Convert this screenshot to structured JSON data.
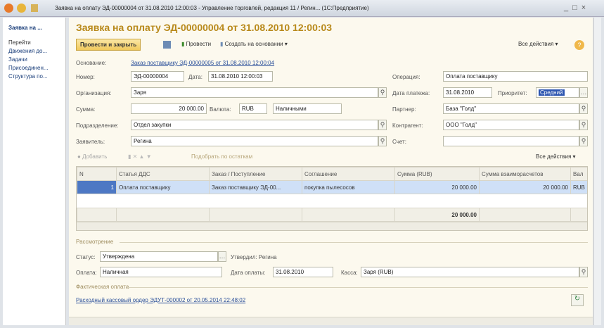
{
  "window": {
    "title": "Заявка на оплату ЭД-00000004 от 31.08.2010 12:00:03 - Управление торговлей, редакция 11 / Регин... (1С:Предприятие)"
  },
  "sidebar": {
    "items": [
      "Заявка на ...",
      "Перейти",
      "Движения до...",
      "Задачи",
      "Присоединен...",
      "Структура по..."
    ]
  },
  "header": {
    "title": "Заявка на оплату ЭД-00000004 от 31.08.2010 12:00:03"
  },
  "toolbar": {
    "post_close": "Провести и закрыть",
    "post": "Провести",
    "create_based": "Создать на основании ▾",
    "all_actions": "Все действия ▾",
    "help": "?"
  },
  "form": {
    "basis_label": "Основание:",
    "basis_link": "Заказ поставщику ЭД-00000005 от 31.08.2010 12:00:04",
    "number_label": "Номер:",
    "number": "ЭД-00000004",
    "date_label": "Дата:",
    "date": "31.08.2010 12:00:03",
    "operation_label": "Операция:",
    "operation": "Оплата поставщику",
    "org_label": "Организация:",
    "org": "Заря",
    "paydate_label": "Дата платежа:",
    "paydate": "31.08.2010",
    "priority_label": "Приоритет:",
    "priority": "Средний",
    "sum_label": "Сумма:",
    "sum": "20 000.00",
    "currency_label": "Валюта:",
    "currency": "RUB",
    "payform": "Наличными",
    "partner_label": "Партнер:",
    "partner": "База \"Голд\"",
    "dept_label": "Подразделение:",
    "dept": "Отдел закупки",
    "contractor_label": "Контрагент:",
    "contractor": "ООО \"Голд\"",
    "applicant_label": "Заявитель:",
    "applicant": "Регина",
    "account_label": "Счет:",
    "account": ""
  },
  "table_toolbar": {
    "add": "Добавить",
    "pick": "Подобрать по остаткам",
    "all_actions": "Все действия ▾"
  },
  "table": {
    "columns": [
      "N",
      "Статья ДДС",
      "Заказ / Поступление",
      "Соглашение",
      "Сумма (RUB)",
      "Сумма взаиморасчетов",
      "Вал"
    ],
    "rows": [
      [
        "1",
        "Оплата поставщику",
        "Заказ поставщику ЭД-00...",
        "покупка пылесосов",
        "20 000.00",
        "20 000.00",
        "RUB"
      ]
    ],
    "total": "20 000.00"
  },
  "review": {
    "section": "Рассмотрение",
    "status_label": "Статус:",
    "status": "Утверждена",
    "approved": "Утвердил: Регина",
    "payment_label": "Оплата:",
    "payment": "Наличная",
    "paydate_label": "Дата оплаты:",
    "paydate": "31.08.2010",
    "cash_label": "Касса:",
    "cash": "Заря (RUB)"
  },
  "actual": {
    "section": "Фактическая оплата",
    "link": "Расходный кассовый ордер ЭДУТ-000002 от 20.05.2014 22:48:02"
  }
}
